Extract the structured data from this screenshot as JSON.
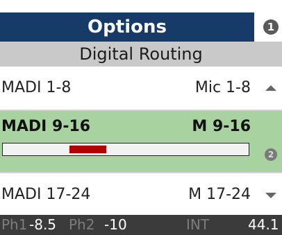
{
  "header": {
    "title": "Options",
    "badge": "1"
  },
  "subtitle": "Digital Routing",
  "routing_rows": [
    {
      "left": "MADI 1-8",
      "right": "Mic 1-8",
      "arrow": "up"
    },
    {
      "left": "MADI 9-16",
      "right": "M 9-16",
      "selected": true,
      "meter_level": 0.22,
      "badge": "2"
    },
    {
      "left": "MADI 17-24",
      "right": "M 17-24",
      "arrow": "down"
    }
  ],
  "status": {
    "ph1_label": "Ph1",
    "ph1_value": "-8.5",
    "ph2_label": "Ph2",
    "ph2_value": "-10",
    "clock": "INT",
    "rate": "44.1"
  },
  "colors": {
    "title_bg": "#163b69",
    "selected_bg": "#a8d2a0",
    "meter_fill": "#b00000",
    "status_bg": "#3b3b3b"
  }
}
